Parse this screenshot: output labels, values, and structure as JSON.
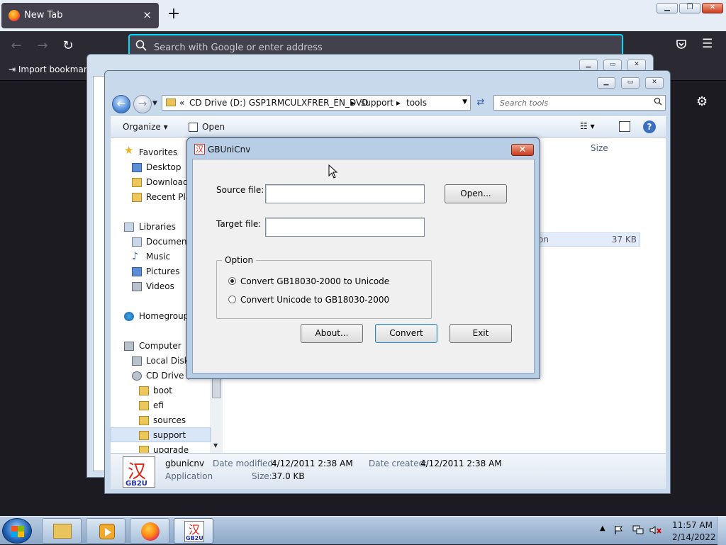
{
  "browser": {
    "tab_title": "New Tab",
    "new_tab_symbol": "+",
    "close_tab_symbol": "×",
    "url_placeholder": "Search with Google or enter address",
    "bookmark_import_label": "Import bookmark"
  },
  "explorer": {
    "breadcrumb": {
      "prefix": "«",
      "drive": "CD Drive (D:) GSP1RMCULXFRER_EN_DVD",
      "folder1": "support",
      "folder2": "tools"
    },
    "search_placeholder": "Search tools",
    "toolbar": {
      "organize": "Organize",
      "open": "Open"
    },
    "column_size": "Size",
    "file_row": {
      "name_fragment": "on",
      "size": "37 KB"
    },
    "nav": {
      "favorites": "Favorites",
      "desktop": "Desktop",
      "downloads": "Downloads",
      "recent": "Recent Plac",
      "libraries": "Libraries",
      "documents": "Document",
      "music": "Music",
      "pictures": "Pictures",
      "videos": "Videos",
      "homegroup": "Homegroup",
      "computer": "Computer",
      "local_disk": "Local Disk",
      "cd_drive": "CD Drive (D",
      "boot": "boot",
      "efi": "efi",
      "sources": "sources",
      "support": "support",
      "upgrade": "upgrade"
    },
    "details": {
      "name": "gbunicnv",
      "type": "Application",
      "modified_label": "Date modified:",
      "modified_value": "4/12/2011 2:38 AM",
      "created_label": "Date created:",
      "created_value": "4/12/2011 2:38 AM",
      "size_label": "Size:",
      "size_value": "37.0 KB",
      "icon_char": "汉",
      "icon_text": "GB2U"
    }
  },
  "dialog": {
    "title": "GBUniCnv",
    "icon_char": "汉",
    "close_symbol": "✕",
    "source_label": "Source file:",
    "source_value": "",
    "target_label": "Target file:",
    "target_value": "",
    "open_button": "Open...",
    "option_legend": "Option",
    "option1": "Convert GB18030-2000 to Unicode",
    "option2": "Convert Unicode to GB18030-2000",
    "selected_option": 1,
    "about_button": "About...",
    "convert_button": "Convert",
    "exit_button": "Exit"
  },
  "taskbar": {
    "time": "11:57 AM",
    "date": "2/14/2022",
    "gbu_icon_char": "汉",
    "gbu_icon_text": "GB2U"
  }
}
